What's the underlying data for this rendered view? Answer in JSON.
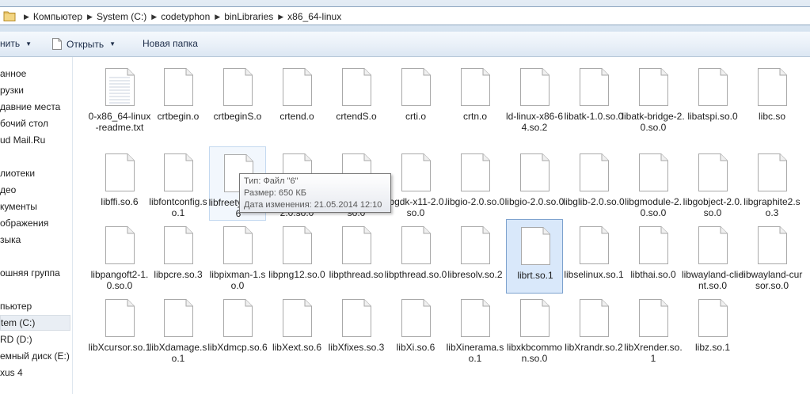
{
  "address_bar": {
    "crumbs": [
      "Компьютер",
      "System (C:)",
      "codetyphon",
      "binLibraries",
      "x86_64-linux"
    ]
  },
  "toolbar": {
    "organize_label": "нить",
    "open_label": "Открыть",
    "new_folder_label": "Новая папка"
  },
  "nav_pane": {
    "items": [
      "анное",
      "рузки",
      "давние места",
      "бочий стол",
      "ud Mail.Ru",
      "лиотеки",
      "део",
      "кументы",
      "ображения",
      "зыка",
      "ошняя группа",
      "пьютер",
      "tem (C:)",
      "RD (D:)",
      "емный диск (E:)",
      "xus 4"
    ],
    "selected_index": 12
  },
  "files": [
    {
      "name": "0-x86_64-linux-readme.txt",
      "type": "txt"
    },
    {
      "name": "crtbegin.o"
    },
    {
      "name": "crtbeginS.o"
    },
    {
      "name": "crtend.o"
    },
    {
      "name": "crtendS.o"
    },
    {
      "name": "crti.o"
    },
    {
      "name": "crtn.o"
    },
    {
      "name": "ld-linux-x86-64.so.2"
    },
    {
      "name": "libatk-1.0.so.0"
    },
    {
      "name": "libatk-bridge-2.0.so.0"
    },
    {
      "name": "libatspi.so.0"
    },
    {
      "name": "libc.so"
    },
    {
      "name": "libffi.so.6"
    },
    {
      "name": "libfontconfig.so.1"
    },
    {
      "name": "libfreetype.so.6",
      "state": "hover"
    },
    {
      "name": "libgdk_pixbuf-2.0.so.0"
    },
    {
      "name": "libgdk-x11-2.0.so.0"
    },
    {
      "name": "libgdk-x11-2.0.so.0"
    },
    {
      "name": "libgio-2.0.so.0"
    },
    {
      "name": "libgio-2.0.so.0"
    },
    {
      "name": "libglib-2.0.so.0"
    },
    {
      "name": "libgmodule-2.0.so.0"
    },
    {
      "name": "libgobject-2.0.so.0"
    },
    {
      "name": "libgraphite2.so.3"
    },
    {
      "name": "libpangoft2-1.0.so.0"
    },
    {
      "name": "libpcre.so.3"
    },
    {
      "name": "libpixman-1.so.0"
    },
    {
      "name": "libpng12.so.0"
    },
    {
      "name": "libpthread.so"
    },
    {
      "name": "libpthread.so.0"
    },
    {
      "name": "libresolv.so.2"
    },
    {
      "name": "librt.so.1",
      "state": "selected"
    },
    {
      "name": "libselinux.so.1"
    },
    {
      "name": "libthai.so.0"
    },
    {
      "name": "libwayland-client.so.0"
    },
    {
      "name": "libwayland-cursor.so.0"
    },
    {
      "name": "libXcursor.so.1"
    },
    {
      "name": "libXdamage.so.1"
    },
    {
      "name": "libXdmcp.so.6"
    },
    {
      "name": "libXext.so.6"
    },
    {
      "name": "libXfixes.so.3"
    },
    {
      "name": "libXi.so.6"
    },
    {
      "name": "libXinerama.so.1"
    },
    {
      "name": "libxkbcommon.so.0"
    },
    {
      "name": "libXrandr.so.2"
    },
    {
      "name": "libXrender.so.1"
    },
    {
      "name": "libz.so.1"
    }
  ],
  "tooltip": {
    "type_line": "Тип: Файл \"6\"",
    "size_line": "Размер: 650 КБ",
    "modified_line": "Дата изменения: 21.05.2014 12:10"
  },
  "colors": {
    "selection_fill": "#d9e8fa",
    "selection_border": "#7da2ce",
    "hover_fill": "#f2f7fd"
  }
}
